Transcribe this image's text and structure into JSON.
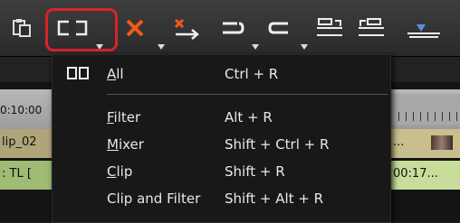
{
  "toolbar": {
    "buttons": [
      {
        "name": "paste-icon"
      },
      {
        "name": "split-clip-icon"
      },
      {
        "name": "delete-icon"
      },
      {
        "name": "ripple-delete-icon"
      },
      {
        "name": "undo-icon"
      },
      {
        "name": "redo-icon"
      },
      {
        "name": "add-in-point-icon"
      },
      {
        "name": "add-out-point-icon"
      },
      {
        "name": "marker-icon"
      }
    ],
    "accent_highlight": "#d8232a"
  },
  "timeline": {
    "ruler_time": "0:10:00",
    "track1_label": "lip_02",
    "track2_label": ": TL [",
    "track1_right": "...",
    "track2_right": "00:17..."
  },
  "menu": {
    "items": [
      {
        "label_u": "A",
        "label_rest": "ll",
        "shortcut": "Ctrl + R",
        "icon": "split-icon"
      },
      {
        "label_u": "F",
        "label_rest": "ilter",
        "shortcut": "Alt + R"
      },
      {
        "label_u": "M",
        "label_rest": "ixer",
        "shortcut": "Shift + Ctrl + R"
      },
      {
        "label_u": "C",
        "label_rest": "lip",
        "shortcut": "Shift + R"
      },
      {
        "label": "Clip and Filter",
        "shortcut": "Shift + Alt + R"
      }
    ]
  }
}
